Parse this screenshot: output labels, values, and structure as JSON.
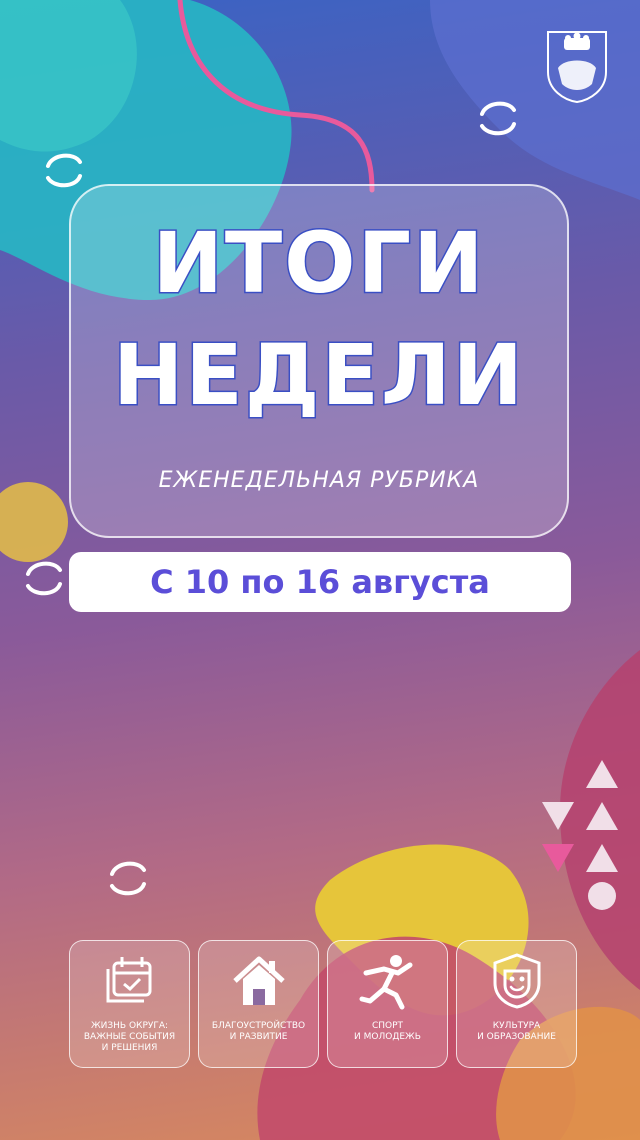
{
  "story": {
    "title_line1": "ИТОГИ",
    "title_line2": "НЕДЕЛИ",
    "subtitle": "ЕЖЕНЕДЕЛЬНАЯ РУБРИКА",
    "date_range": "С 10 по 16 августа"
  },
  "categories": [
    {
      "label": "ЖИЗНЬ ОКРУГА:\nВАЖНЫЕ СОБЫТИЯ\nИ РЕШЕНИЯ",
      "icon": "calendar-check-icon"
    },
    {
      "label": "БЛАГОУСТРОЙСТВО\nИ РАЗВИТИЕ",
      "icon": "house-icon"
    },
    {
      "label": "СПОРТ\nИ МОЛОДЕЖЬ",
      "icon": "running-person-icon"
    },
    {
      "label": "КУЛЬТУРА\nИ ОБРАЗОВАНИЕ",
      "icon": "theater-mask-icon"
    }
  ],
  "colors": {
    "title_stroke": "#3a4fc4",
    "date_text": "#5b4ed8",
    "teal_blob": "#27b7c4",
    "yellow_blob": "#e6c53a",
    "pink_line": "#e85a9c",
    "magenta_blob": "#b5426e"
  },
  "logo": {
    "icon": "coat-of-arms-icon"
  }
}
